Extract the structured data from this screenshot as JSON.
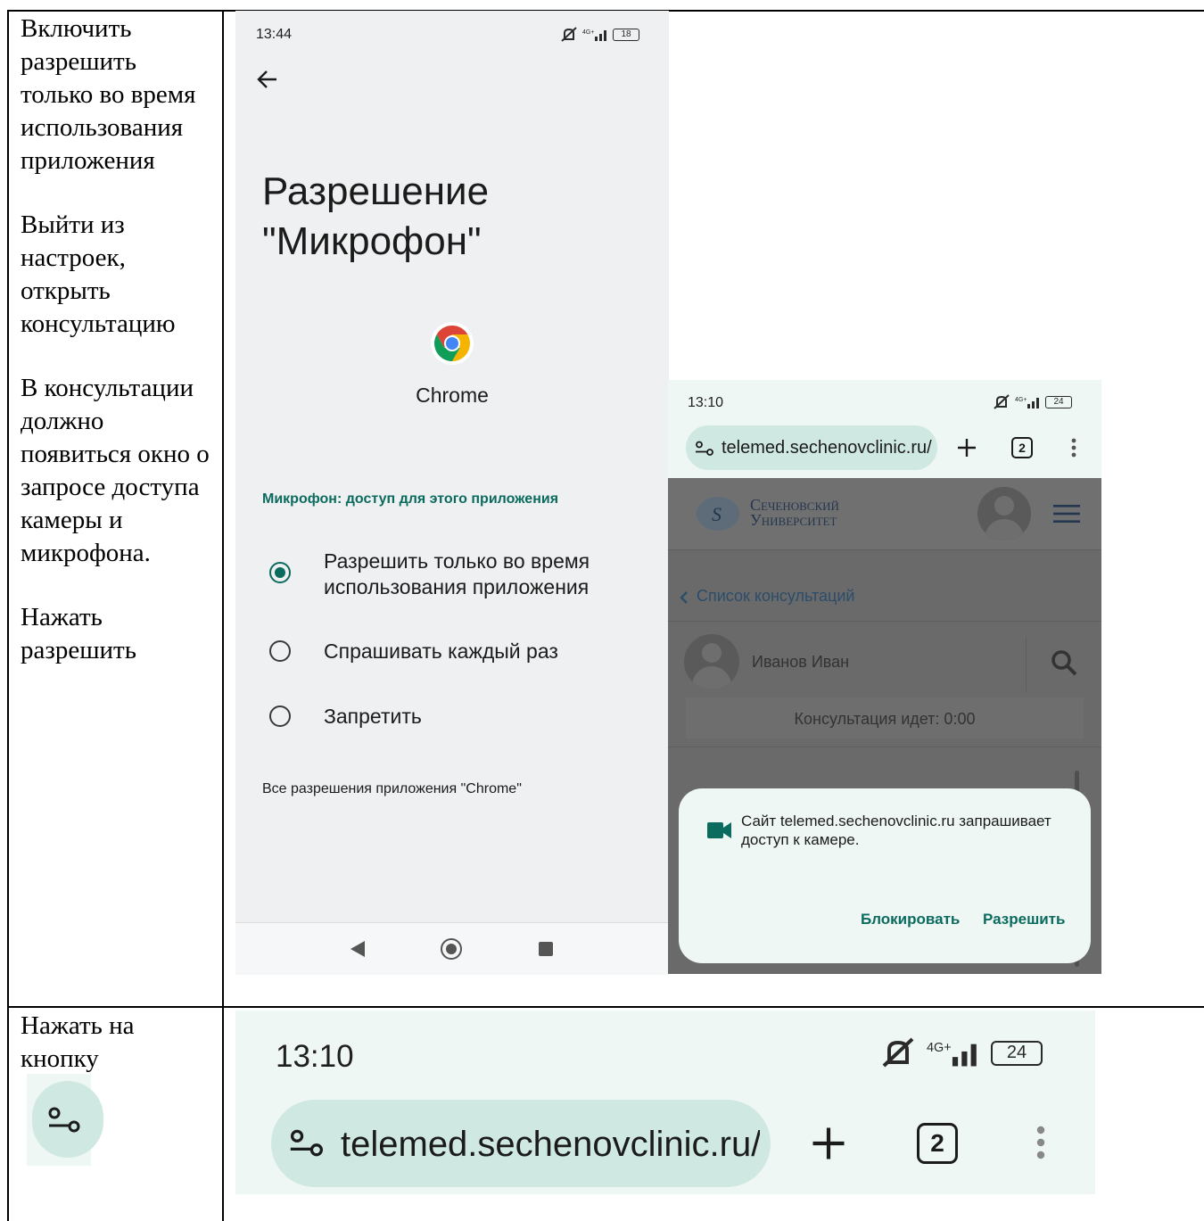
{
  "instructions": {
    "p1": "Включить разрешить только во время использования приложения",
    "p2": "Выйти из настроек, открыть консультацию",
    "p3": "В консультации должно появиться окно о запросе доступа камеры и микрофона.",
    "p4": "Нажать разрешить",
    "p5": "Нажать на кнопку"
  },
  "permission_screen": {
    "time": "13:44",
    "battery": "18",
    "network": "4G+",
    "title": "Разрешение\n\"Микрофон\"",
    "app_name": "Chrome",
    "section_label": "Микрофон: доступ для этого приложения",
    "options": [
      {
        "label": "Разрешить только во время использования приложения",
        "selected": true
      },
      {
        "label": "Спрашивать каждый раз",
        "selected": false
      },
      {
        "label": "Запретить",
        "selected": false
      }
    ],
    "all_permissions_link": "Все разрешения приложения \"Chrome\""
  },
  "browser_screen": {
    "time": "13:10",
    "battery": "24",
    "network": "4G+",
    "url": "telemed.sechenovclinic.ru/",
    "tab_count": "2",
    "site_logo_line1": "Сеченовский",
    "site_logo_line2": "Университет",
    "back_link": "Список консультаций",
    "doctor_name": "Иванов Иван",
    "consultation_status": "Консультация идет: 0:00",
    "dialog": {
      "message": "Сайт telemed.sechenovclinic.ru запрашивает доступ к камере.",
      "block_label": "Блокировать",
      "allow_label": "Разрешить"
    }
  },
  "zoomed_bar": {
    "time": "13:10",
    "battery": "24",
    "network": "4G+",
    "url": "telemed.sechenovclinic.ru/",
    "tab_count": "2"
  },
  "colors": {
    "accent": "#0b6b5e",
    "chrome_bar": "#eef7f4",
    "url_pill": "#cfe8e1",
    "settings_bg": "#eff0f2"
  }
}
